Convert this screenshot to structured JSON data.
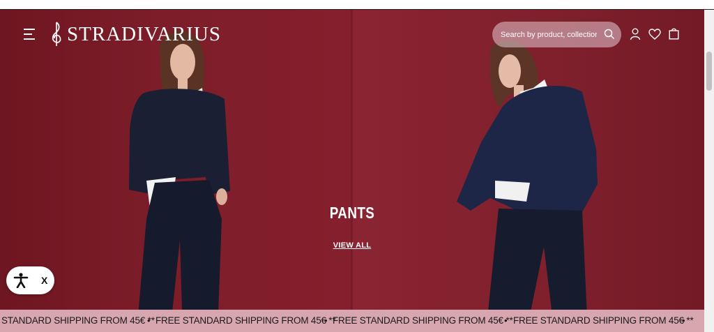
{
  "brand": {
    "name": "STRADIVARIUS"
  },
  "header": {
    "menu_icon": "hamburger-menu-icon",
    "search": {
      "placeholder": "Search by product, collection..."
    },
    "icons": [
      "user-account-icon",
      "heart-wishlist-icon",
      "shopping-bag-icon"
    ]
  },
  "hero": {
    "title": "PANTS",
    "cta": "VIEW ALL",
    "colors": {
      "background": "#7a1b28",
      "text": "#ffffff"
    }
  },
  "accessibility_widget": {
    "icon": "accessibility-person-icon",
    "close_label": "X"
  },
  "ticker": {
    "items": [
      "STANDARD SHIPPING FROM 45€ **",
      "FREE STANDARD SHIPPING FROM 45€ **",
      "FREE STANDARD SHIPPING FROM 45€ **",
      "FREE STANDARD SHIPPING FROM 45€ **"
    ],
    "separator": "•",
    "color": "#d8a6ae"
  }
}
